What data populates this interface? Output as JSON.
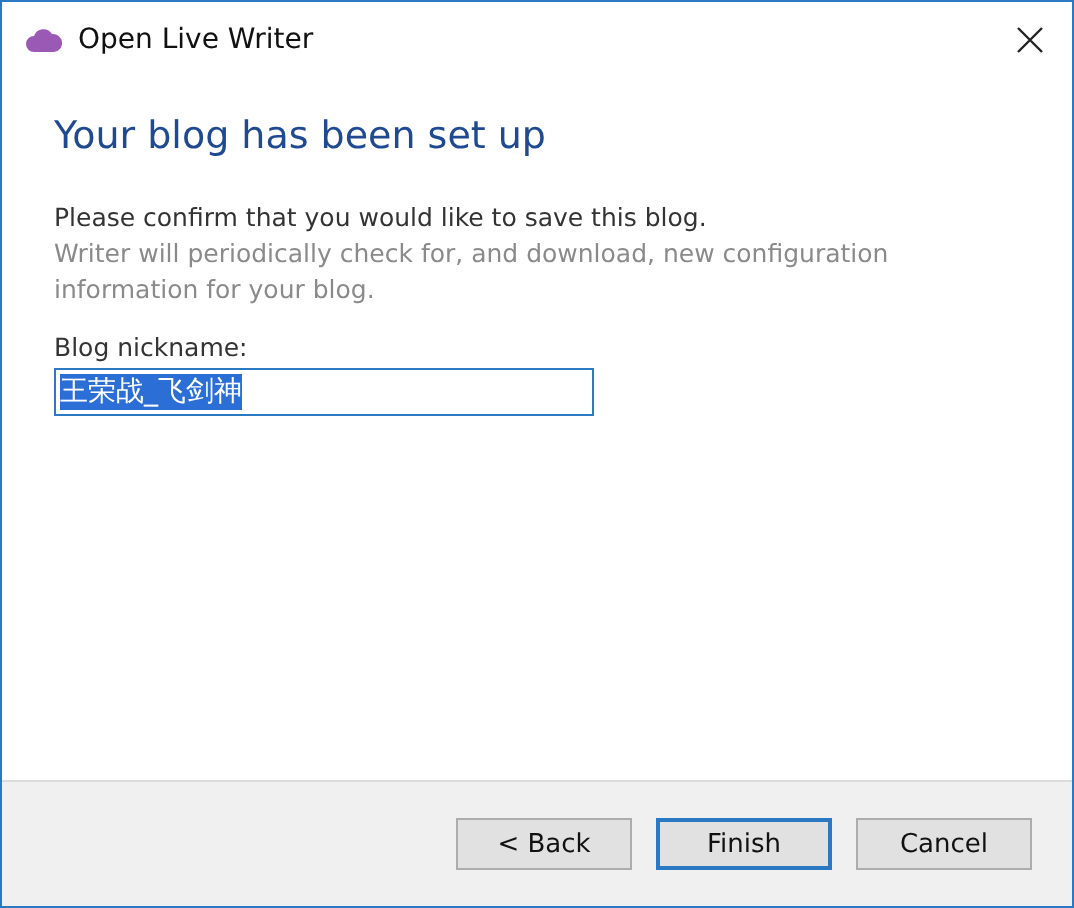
{
  "window": {
    "title": "Open Live Writer"
  },
  "heading": "Your blog has been set up",
  "prompt": "Please confirm that you would like to save this blog.",
  "note": "Writer will periodically check for, and download, new configuration information for your blog.",
  "nickname": {
    "label": "Blog nickname:",
    "value": "王荣战_飞剑神",
    "selected": true
  },
  "buttons": [
    {
      "label": "< Back",
      "default": false
    },
    {
      "label": "Finish",
      "default": true
    },
    {
      "label": "Cancel",
      "default": false
    }
  ]
}
